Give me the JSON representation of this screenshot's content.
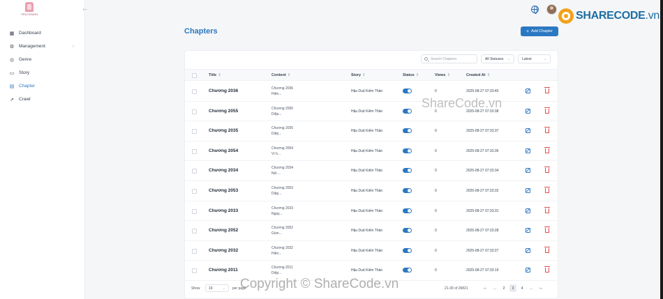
{
  "app": {
    "logo_text": "TRUYENHH"
  },
  "sidebar": {
    "items": [
      {
        "label": "Dashboard",
        "icon": "grid-icon",
        "active": false
      },
      {
        "label": "Management",
        "icon": "gear-icon",
        "active": false,
        "expandable": true
      },
      {
        "label": "Genre",
        "icon": "tag-circle-icon",
        "active": false
      },
      {
        "label": "Story",
        "icon": "book-icon",
        "active": false
      },
      {
        "label": "Chapter",
        "icon": "document-icon",
        "active": true
      },
      {
        "label": "Crawl",
        "icon": "rocket-icon",
        "active": false
      }
    ]
  },
  "header": {
    "brand": "SHARECODE",
    "brand_suffix": ".vn"
  },
  "page": {
    "title": "Chapters",
    "add_button": "Add Chapter"
  },
  "filters": {
    "search_placeholder": "Search Chapters",
    "status_value": "All Statuses",
    "order_value": "Latest"
  },
  "table": {
    "columns": [
      "Title",
      "Content",
      "Story",
      "Status",
      "Views",
      "Created At"
    ],
    "rows": [
      {
        "title": "Chương 2036",
        "content_1": "Chương 2036",
        "content_2": "Hiên...",
        "story": "Hậu Duệ Kiếm Thần",
        "status": true,
        "views": "0",
        "created": "2025-08-27 07:33:40"
      },
      {
        "title": "Chương 2055",
        "content_1": "Chương 2055",
        "content_2": "Diệp...",
        "story": "Hậu Duệ Kiếm Thần",
        "status": true,
        "views": "0",
        "created": "2025-08-27 07:33:38"
      },
      {
        "title": "Chương 2035",
        "content_1": "Chương 2035",
        "content_2": "Diệp...",
        "story": "Hậu Duệ Kiếm Thần",
        "status": true,
        "views": "0",
        "created": "2025-08-27 07:33:37"
      },
      {
        "title": "Chương 2054",
        "content_1": "Chương 2054",
        "content_2": "Vì h...",
        "story": "Hậu Duệ Kiếm Thần",
        "status": true,
        "views": "0",
        "created": "2025-08-27 07:33:35"
      },
      {
        "title": "Chương 2034",
        "content_1": "Chương 2034",
        "content_2": "Nói ...",
        "story": "Hậu Duệ Kiếm Thần",
        "status": true,
        "views": "0",
        "created": "2025-08-27 07:33:34"
      },
      {
        "title": "Chương 2053",
        "content_1": "Chương 2053",
        "content_2": "Diệp...",
        "story": "Hậu Duệ Kiếm Thần",
        "status": true,
        "views": "0",
        "created": "2025-08-27 07:33:32"
      },
      {
        "title": "Chương 2033",
        "content_1": "Chương 2033",
        "content_2": "Ngay...",
        "story": "Hậu Duệ Kiếm Thần",
        "status": true,
        "views": "0",
        "created": "2025-08-27 07:33:31"
      },
      {
        "title": "Chương 2052",
        "content_1": "Chương 2052",
        "content_2": "Giọn...",
        "story": "Hậu Duệ Kiếm Thần",
        "status": true,
        "views": "0",
        "created": "2025-08-27 07:33:28"
      },
      {
        "title": "Chương 2032",
        "content_1": "Chương 2032",
        "content_2": "Hiên...",
        "story": "Hậu Duệ Kiếm Thần",
        "status": true,
        "views": "0",
        "created": "2025-08-27 07:33:27"
      },
      {
        "title": "Chương 2011",
        "content_1": "Chương 2011",
        "content_2": "Diệp...",
        "story": "Hậu Duệ Kiếm Thần",
        "status": true,
        "views": "0",
        "created": "2025-08-27 07:33:19"
      }
    ]
  },
  "footer": {
    "show_label": "Show",
    "page_size": "10",
    "per_page_label": "per page",
    "range": "21-30 of 26821",
    "pages": [
      "...",
      "2",
      "3",
      "4",
      "..."
    ],
    "current_page": "3"
  },
  "watermark": {
    "center": "ShareCode.vn",
    "bottom": "Copyright © ShareCode.vn"
  },
  "colors": {
    "accent": "#2b78c2",
    "danger": "#e04a4a",
    "brand_orange": "#f3a21b"
  }
}
